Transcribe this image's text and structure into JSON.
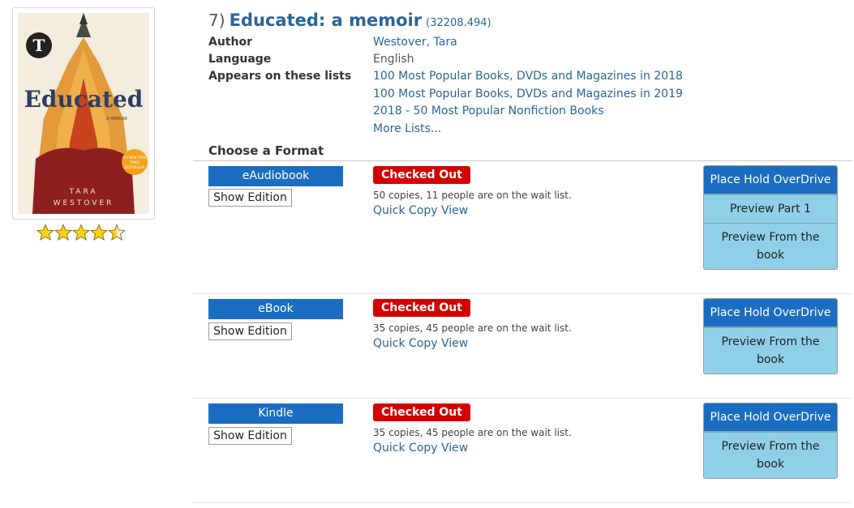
{
  "record": {
    "number": "7)",
    "title": "Educated: a memoir",
    "id": "(32208.494)",
    "rating_stars": 4.5
  },
  "cover": {
    "title": "Educated",
    "subtitle": "A MEMOIR",
    "author_line1": "TARA",
    "author_line2": "WESTOVER",
    "badge": "#1 NEW YORK TIMES BESTSELLER",
    "badge_line1": "#1 NEW YORK",
    "badge_line2": "TIMES",
    "badge_line3": "BESTSELLER"
  },
  "meta": {
    "author_label": "Author",
    "author_value": "Westover, Tara",
    "language_label": "Language",
    "language_value": "English",
    "lists_label": "Appears on these lists",
    "lists": [
      "100 Most Popular Books, DVDs and Magazines in 2018",
      "100 Most Popular Books, DVDs and Magazines in 2019",
      "2018 - 50 Most Popular Nonfiction Books",
      "More Lists..."
    ]
  },
  "choose_format": "Choose a Format",
  "formats": [
    {
      "format": "eAudiobook",
      "show_edition": "Show Edition",
      "status": "Checked Out",
      "copies": "50 copies, 11 people are on the wait list.",
      "quick_copy": "Quick Copy View",
      "place_hold": "Place Hold OverDrive",
      "preview_part": "Preview Part 1",
      "preview_book": "Preview From the book"
    },
    {
      "format": "eBook",
      "show_edition": "Show Edition",
      "status": "Checked Out",
      "copies": "35 copies, 45 people are on the wait list.",
      "quick_copy": "Quick Copy View",
      "place_hold": "Place Hold OverDrive",
      "preview_book": "Preview From the book"
    },
    {
      "format": "Kindle",
      "show_edition": "Show Edition",
      "status": "Checked Out",
      "copies": "35 copies, 45 people are on the wait list.",
      "quick_copy": "Quick Copy View",
      "place_hold": "Place Hold OverDrive",
      "preview_book": "Preview From the book"
    }
  ],
  "colors": {
    "link": "#2a6496",
    "format_button": "#1a6dc0",
    "status_red": "#d40000",
    "preview_button": "#8fd0e8"
  }
}
